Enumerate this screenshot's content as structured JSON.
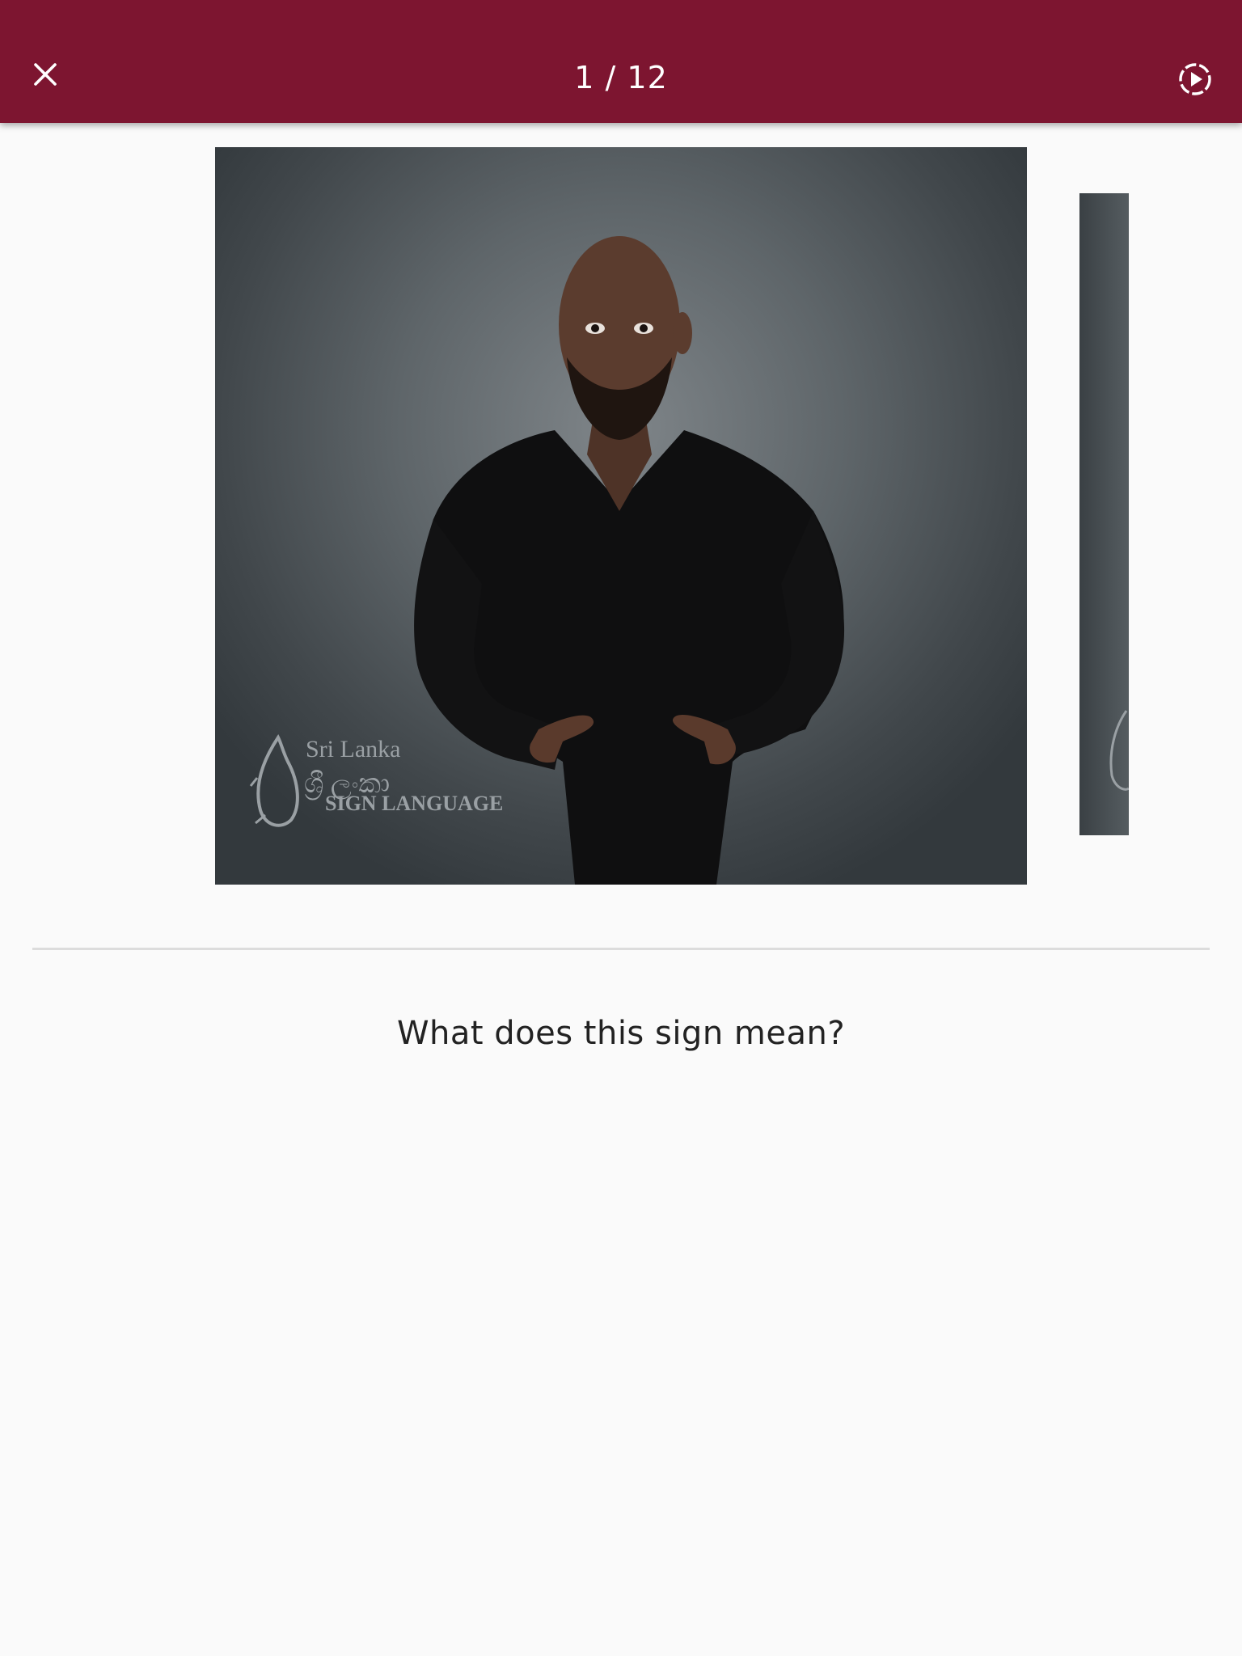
{
  "app_bar": {
    "page_indicator": "1 / 12",
    "background": "#7d1530",
    "close_icon": "close-icon",
    "autoplay_icon": "autoplay-icon"
  },
  "video": {
    "watermark": {
      "line1": "Sri Lanka",
      "line2": "ශ්‍රී ලංකා",
      "line3": "SIGN LANGUAGE"
    }
  },
  "quiz": {
    "question": "What does this sign mean?"
  }
}
